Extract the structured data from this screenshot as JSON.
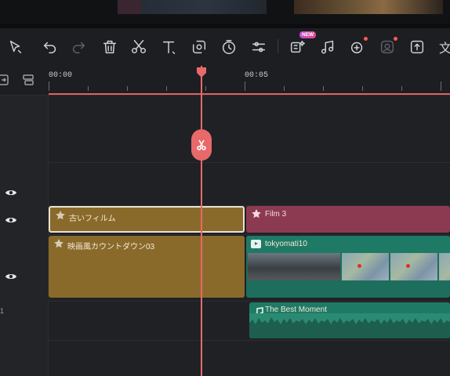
{
  "toolbar": {
    "icons": [
      "select-tool-icon",
      "undo-icon",
      "redo-icon",
      "delete-icon",
      "split-icon",
      "text-icon",
      "crop-icon",
      "speed-icon",
      "adjust-icon",
      "ai-feature-icon",
      "audio-icon",
      "ai-sticker-icon",
      "ai-portrait-icon",
      "export-frame-icon",
      "translate-icon"
    ],
    "new_badge": "NEW",
    "translate_glyph": "文"
  },
  "ruler": {
    "start_label": "00:00",
    "mid_label": "00:05"
  },
  "tracks": {
    "effect_clip_1": "古いフィルム",
    "effect_clip_2": "Film 3",
    "effect_clip_3": "映画風カウントダウン03",
    "video_clip": "tokyomati10",
    "audio_clip": "The Best Moment",
    "audio_track_num": "1"
  },
  "colors": {
    "playhead": "#e8696a",
    "effect_gold": "#8a6a2a",
    "effect_pink": "#8c3a52",
    "video_teal": "#1d6e5c"
  }
}
